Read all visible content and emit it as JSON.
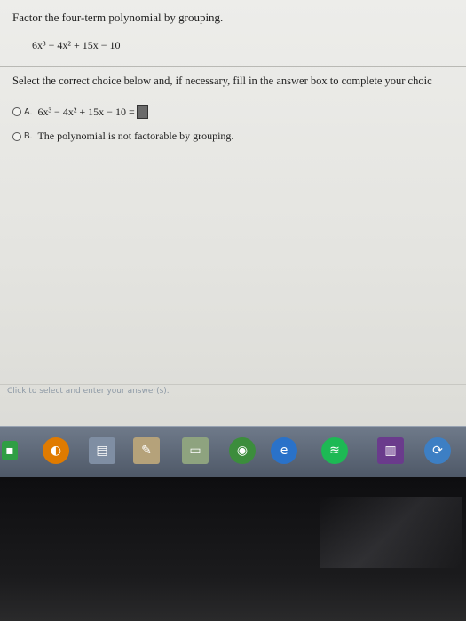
{
  "question": {
    "prompt": "Factor the four-term polynomial by grouping.",
    "expression": "6x³ − 4x² + 15x − 10"
  },
  "instruction": "Select the correct choice below and, if necessary, fill in the answer box to complete your choic",
  "choices": [
    {
      "letter": "A.",
      "text": "6x³ − 4x² + 15x − 10 ="
    },
    {
      "letter": "B.",
      "text": "The polynomial is not factorable by grouping."
    }
  ],
  "hint": "Click to select and enter your answer(s).",
  "taskbar": {
    "icons": [
      {
        "name": "start-icon",
        "glyph": "▪",
        "color": "#2f9e44"
      },
      {
        "name": "browser-icon",
        "glyph": "◐",
        "color": "#e07b00"
      },
      {
        "name": "file-explorer-icon",
        "glyph": "▤",
        "color": "#7f8ea3"
      },
      {
        "name": "notepad-icon",
        "glyph": "✎",
        "color": "#b5a27a"
      },
      {
        "name": "folder-icon",
        "glyph": "▭",
        "color": "#8ea37f"
      },
      {
        "name": "chrome-icon",
        "glyph": "◉",
        "color": "#3c8d3c"
      },
      {
        "name": "internet-explorer-icon",
        "glyph": "e",
        "color": "#2a72c9"
      },
      {
        "name": "spotify-icon",
        "glyph": "≋",
        "color": "#1db954"
      },
      {
        "name": "winrar-icon",
        "glyph": "▥",
        "color": "#6a3b8c"
      },
      {
        "name": "sync-icon",
        "glyph": "⟳",
        "color": "#3d7fc4"
      }
    ]
  }
}
